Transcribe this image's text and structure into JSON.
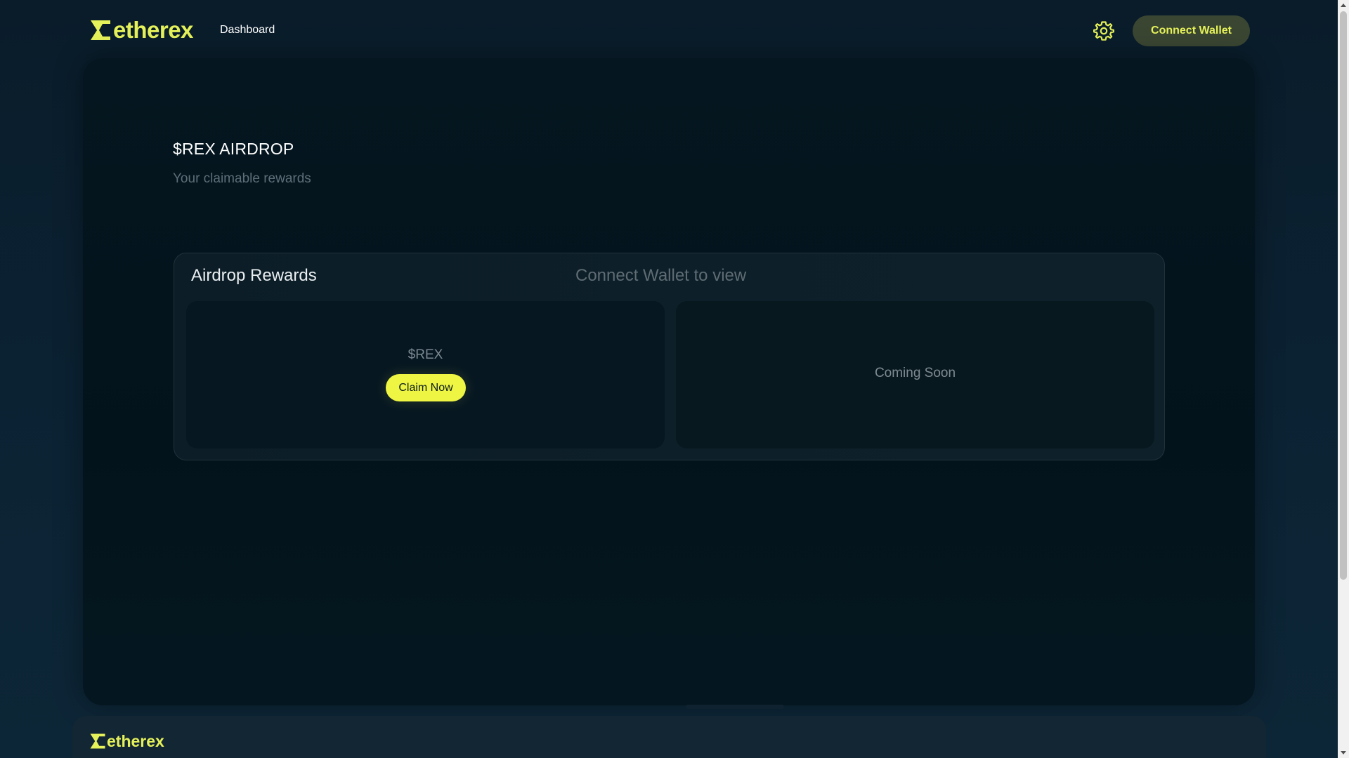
{
  "header": {
    "logo_text": "etherex",
    "nav_dashboard": "Dashboard",
    "connect_label": "Connect Wallet",
    "settings_icon": "gear-icon"
  },
  "main": {
    "title": "$REX AIRDROP",
    "subtitle": "Your claimable rewards",
    "rewards": {
      "title": "Airdrop Rewards",
      "status": "Connect Wallet to view",
      "token_label": "$REX",
      "claim_label": "Claim Now",
      "coming_soon": "Coming Soon"
    }
  },
  "footer": {
    "logo_text": "etherex"
  },
  "colors": {
    "accent": "#e6f25a",
    "button_yellow": "#eef542",
    "background": "#0b2030",
    "panel": "#041720"
  }
}
